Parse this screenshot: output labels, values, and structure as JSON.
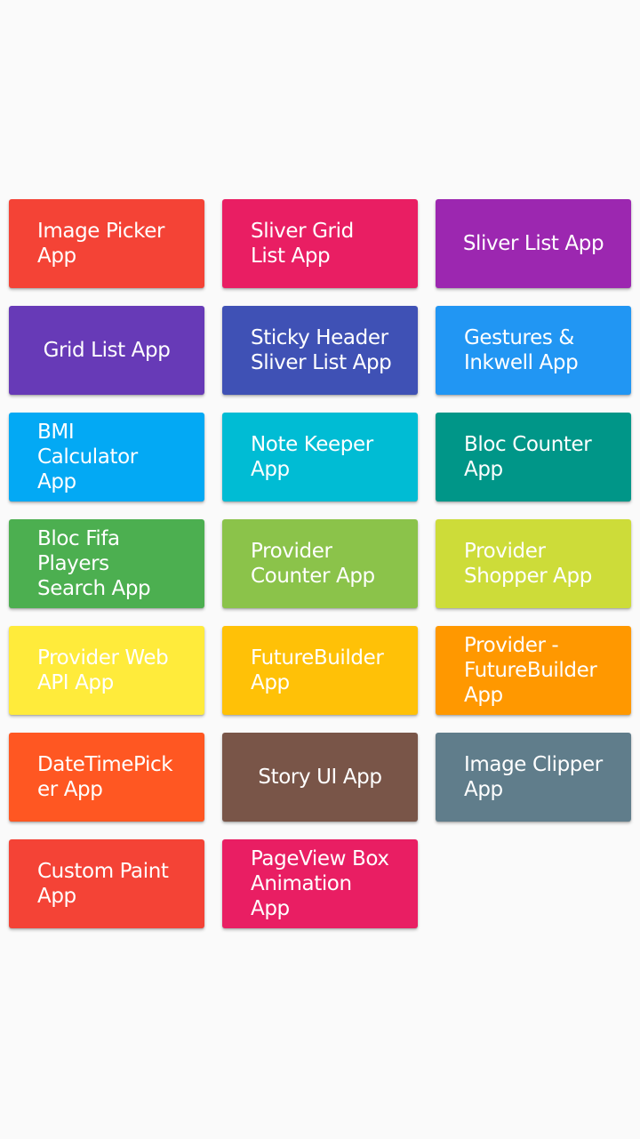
{
  "tiles": [
    {
      "label": "Image Picker App",
      "color": "#f44336"
    },
    {
      "label": "Sliver Grid List App",
      "color": "#e91e63"
    },
    {
      "label": "Sliver List App",
      "color": "#9c27b0"
    },
    {
      "label": "Grid List App",
      "color": "#673ab7"
    },
    {
      "label": "Sticky Header Sliver List App",
      "color": "#3f51b5"
    },
    {
      "label": "Gestures & Inkwell App",
      "color": "#2196f3"
    },
    {
      "label": "BMI Calculator App",
      "color": "#03a9f4"
    },
    {
      "label": "Note Keeper App",
      "color": "#00bcd4"
    },
    {
      "label": "Bloc Counter App",
      "color": "#009688"
    },
    {
      "label": "Bloc Fifa Players Search App",
      "color": "#4caf50"
    },
    {
      "label": "Provider Counter App",
      "color": "#8bc34a"
    },
    {
      "label": "Provider Shopper App",
      "color": "#cddc39"
    },
    {
      "label": "Provider Web API App",
      "color": "#ffeb3b"
    },
    {
      "label": "FutureBuilder App",
      "color": "#ffc107"
    },
    {
      "label": "Provider - FutureBuilder App",
      "color": "#ff9800"
    },
    {
      "label": "DateTimePicker App",
      "color": "#ff5722"
    },
    {
      "label": "Story UI App",
      "color": "#795548"
    },
    {
      "label": "Image Clipper App",
      "color": "#607d8b"
    },
    {
      "label": "Custom Paint App",
      "color": "#f44336"
    },
    {
      "label": "PageView Box Animation App",
      "color": "#e91e63"
    }
  ]
}
